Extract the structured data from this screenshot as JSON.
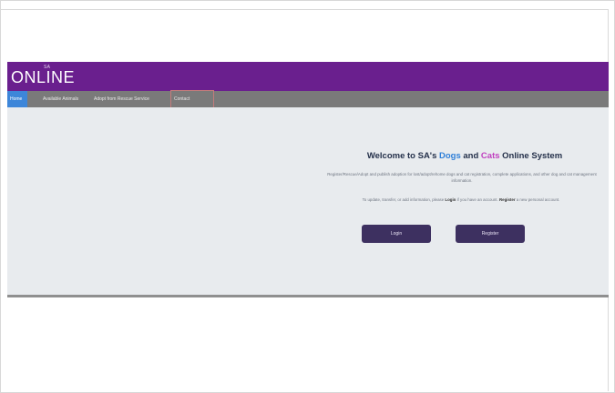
{
  "logo": {
    "top_text": "SA",
    "main_text": "ONLINE"
  },
  "nav": {
    "items": [
      {
        "label": "Home",
        "active": true
      },
      {
        "label": "Available Animals"
      },
      {
        "label": "Adopt from Rescue Service"
      },
      {
        "label": "Contact"
      }
    ]
  },
  "welcome": {
    "prefix": "Welcome to SA's ",
    "dogs": "Dogs",
    "and": " and ",
    "cats": "Cats",
    "suffix": " Online System"
  },
  "description": {
    "line1": "Register/Rescue/Adopt and publish adoption for lost/adopt/rehome dogs and cat registration, complete applications, and other dog and cat management information.",
    "line2_pre": "To update, transfer, or add information, please ",
    "login_word": "Login",
    "line2_mid": " if you have an account. ",
    "register_word": "Register",
    "line2_post": " a new personal account."
  },
  "buttons": {
    "login": "Login",
    "register": "Register"
  },
  "colors": {
    "banner": "#6a1f8e",
    "nav": "#7a7a7a",
    "nav_active": "#3d86d9",
    "button": "#3d3060",
    "dogs": "#2f7fd8",
    "cats": "#c03fbf"
  }
}
